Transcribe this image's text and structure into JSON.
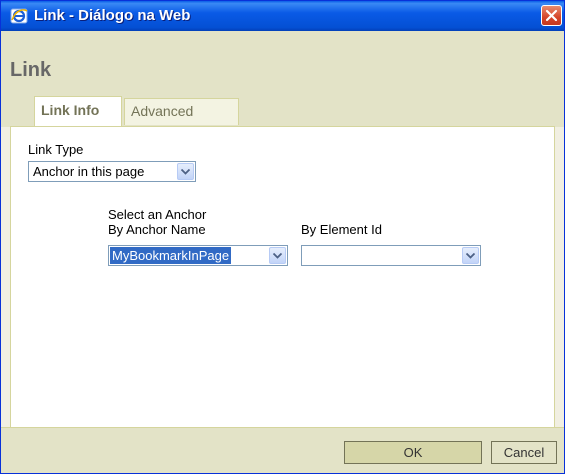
{
  "window": {
    "title": "Link - Diálogo na Web"
  },
  "dialog": {
    "heading": "Link"
  },
  "tabs": [
    {
      "label": "Link Info",
      "active": true
    },
    {
      "label": "Advanced",
      "active": false
    }
  ],
  "link_type": {
    "label": "Link Type",
    "value": "Anchor in this page"
  },
  "anchor": {
    "section_label": "Select an Anchor",
    "by_name_label": "By Anchor Name",
    "by_name_value": "MyBookmarkInPage",
    "by_id_label": "By Element Id",
    "by_id_value": ""
  },
  "buttons": {
    "ok": "OK",
    "cancel": "Cancel"
  },
  "colors": {
    "titlebar": "#0a5ae6",
    "panel_bg": "#e3e3c7",
    "border": "#d5d59d",
    "selection": "#316ac5"
  }
}
